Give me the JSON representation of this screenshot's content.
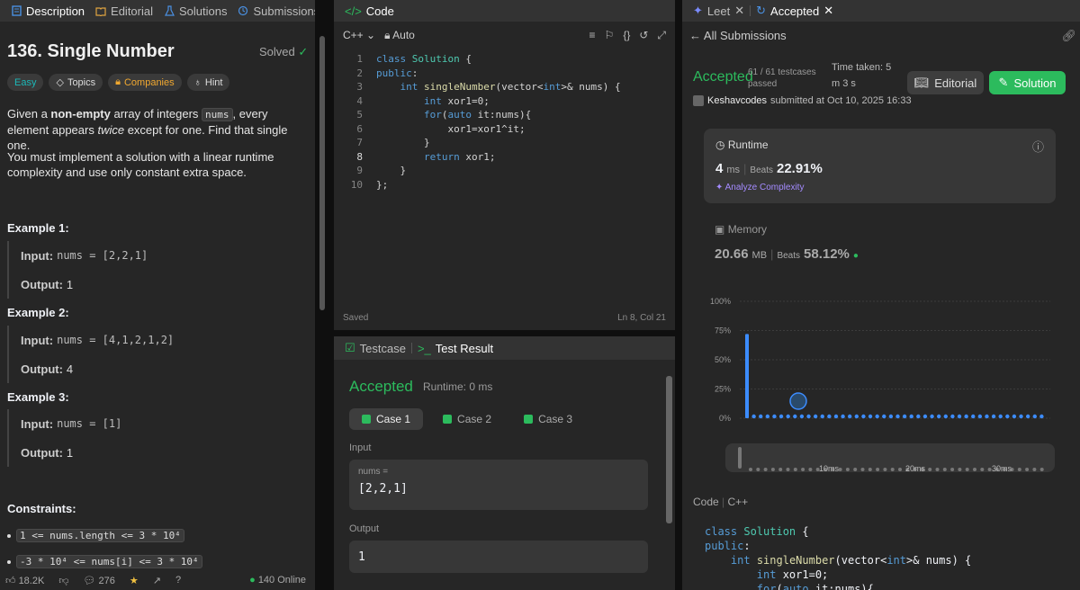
{
  "left": {
    "tabs": [
      "Description",
      "Editorial",
      "Solutions",
      "Submissions"
    ],
    "title": "136. Single Number",
    "solved": "Solved",
    "chips": [
      "Easy",
      "Topics",
      "Companies",
      "Hint"
    ],
    "desc1_a": "Given a ",
    "desc1_b": "non-empty",
    "desc1_c": " array of integers ",
    "desc1_code": "nums",
    "desc1_d": ", every element appears ",
    "desc1_e": "twice",
    "desc1_f": " except for one. Find that single one.",
    "desc2": "You must implement a solution with a linear runtime complexity and use only constant extra space.",
    "examples": [
      {
        "head": "Example 1:",
        "input_label": "Input:",
        "input": "nums = [2,2,1]",
        "output_label": "Output:",
        "output": "1"
      },
      {
        "head": "Example 2:",
        "input_label": "Input:",
        "input": "nums = [4,1,2,1,2]",
        "output_label": "Output:",
        "output": "4"
      },
      {
        "head": "Example 3:",
        "input_label": "Input:",
        "input": "nums = [1]",
        "output_label": "Output:",
        "output": "1"
      }
    ],
    "constraints_head": "Constraints:",
    "constraints": [
      "1 <= nums.length <= 3 * 10⁴",
      "-3 * 10⁴ <= nums[i] <= 3 * 10⁴"
    ],
    "footer": {
      "likes": "18.2K",
      "comments": "276",
      "online": "140 Online"
    }
  },
  "code": {
    "tab": "Code",
    "lang": "C++",
    "mode": "Auto",
    "lines": [
      "class Solution {",
      "public:",
      "    int singleNumber(vector<int>& nums) {",
      "        int xor1=0;",
      "        for(auto it:nums){",
      "            xor1=xor1^it;",
      "        }",
      "        return xor1;",
      "    }",
      "};"
    ],
    "status": "Saved",
    "cursor": "Ln 8, Col 21"
  },
  "test": {
    "tabs": [
      "Testcase",
      "Test Result"
    ],
    "result": "Accepted",
    "runtime": "Runtime: 0 ms",
    "cases": [
      "Case 1",
      "Case 2",
      "Case 3"
    ],
    "input_label": "Input",
    "input_name": "nums =",
    "input_value": "[2,2,1]",
    "output_label": "Output",
    "output_value": "1"
  },
  "right": {
    "tabs": [
      "Leet",
      "Accepted"
    ],
    "back": "All Submissions",
    "status": "Accepted",
    "testcases": "61 / 61 testcases",
    "passed": "passed",
    "time_taken_label": "Time taken: 5",
    "time_taken_value": "m 3 s",
    "editorial_btn": "Editorial",
    "solution_btn": "Solution",
    "user": "Keshavcodes",
    "submitted": "submitted at Oct 10, 2025 16:33",
    "runtime_label": "Runtime",
    "runtime_value": "4",
    "runtime_unit": "ms",
    "beats_label": "Beats",
    "runtime_beats": "22.91%",
    "analyze": "Analyze Complexity",
    "memory_label": "Memory",
    "memory_value": "20.66",
    "memory_unit": "MB",
    "memory_beats": "58.12%",
    "code_label": "Code",
    "code_lang": "C++",
    "code_lines": [
      "class Solution {",
      "public:",
      "    int singleNumber(vector<int>& nums) {",
      "        int xor1=0;",
      "        for(auto it:nums){"
    ]
  },
  "chart_data": {
    "type": "bar",
    "yticks": [
      "100%",
      "75%",
      "50%",
      "25%",
      "0%"
    ],
    "xticks": [
      "10ms",
      "20ms",
      "30ms"
    ],
    "ylim": [
      0,
      100
    ],
    "values": [
      72,
      2,
      2,
      2,
      2,
      2,
      2,
      2,
      2,
      2,
      2,
      2,
      2,
      2,
      2,
      2,
      2,
      2,
      2,
      2,
      2,
      2,
      2,
      2,
      2,
      2,
      2,
      2,
      2,
      2,
      2,
      2,
      2,
      2,
      2,
      2,
      2,
      2,
      2,
      2,
      2,
      2,
      2,
      2
    ]
  }
}
